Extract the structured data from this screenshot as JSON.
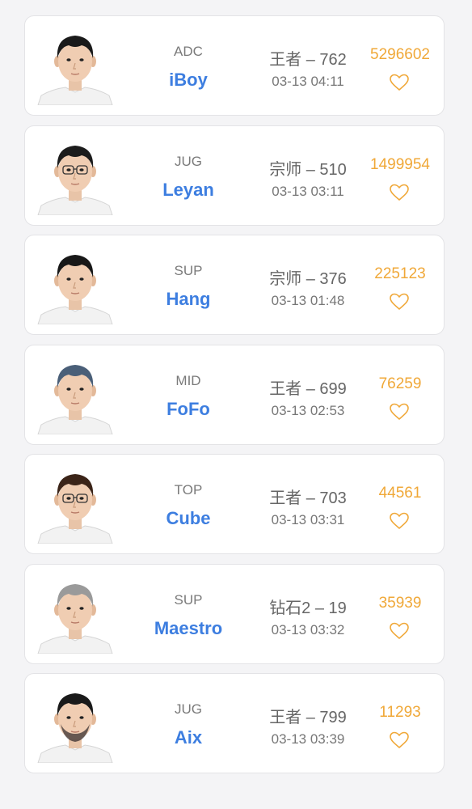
{
  "players": [
    {
      "role": "ADC",
      "name": "iBoy",
      "rank": "王者 – 762",
      "time": "03-13 04:11",
      "likes": "5296602",
      "hair": "#1a1a1a",
      "glasses": false,
      "beard": false
    },
    {
      "role": "JUG",
      "name": "Leyan",
      "rank": "宗师 – 510",
      "time": "03-13 03:11",
      "likes": "1499954",
      "hair": "#1c1c1c",
      "glasses": true,
      "beard": false
    },
    {
      "role": "SUP",
      "name": "Hang",
      "rank": "宗师 – 376",
      "time": "03-13 01:48",
      "likes": "225123",
      "hair": "#181818",
      "glasses": false,
      "beard": false
    },
    {
      "role": "MID",
      "name": "FoFo",
      "rank": "王者 – 699",
      "time": "03-13 02:53",
      "likes": "76259",
      "hair": "#4a5f78",
      "glasses": false,
      "beard": false
    },
    {
      "role": "TOP",
      "name": "Cube",
      "rank": "王者 – 703",
      "time": "03-13 03:31",
      "likes": "44561",
      "hair": "#3b2418",
      "glasses": true,
      "beard": false
    },
    {
      "role": "SUP",
      "name": "Maestro",
      "rank": "钻石2 – 19",
      "time": "03-13 03:32",
      "likes": "35939",
      "hair": "#9a9a9a",
      "glasses": false,
      "beard": false
    },
    {
      "role": "JUG",
      "name": "Aix",
      "rank": "王者 – 799",
      "time": "03-13 03:39",
      "likes": "11293",
      "hair": "#1a1a1a",
      "glasses": false,
      "beard": true
    }
  ],
  "colors": {
    "name": "#3d7ee0",
    "likes": "#f0a838",
    "role": "#7a7a7a"
  },
  "icons": {
    "like": "heart-outline-icon",
    "avatar": "player-avatar-photo"
  }
}
